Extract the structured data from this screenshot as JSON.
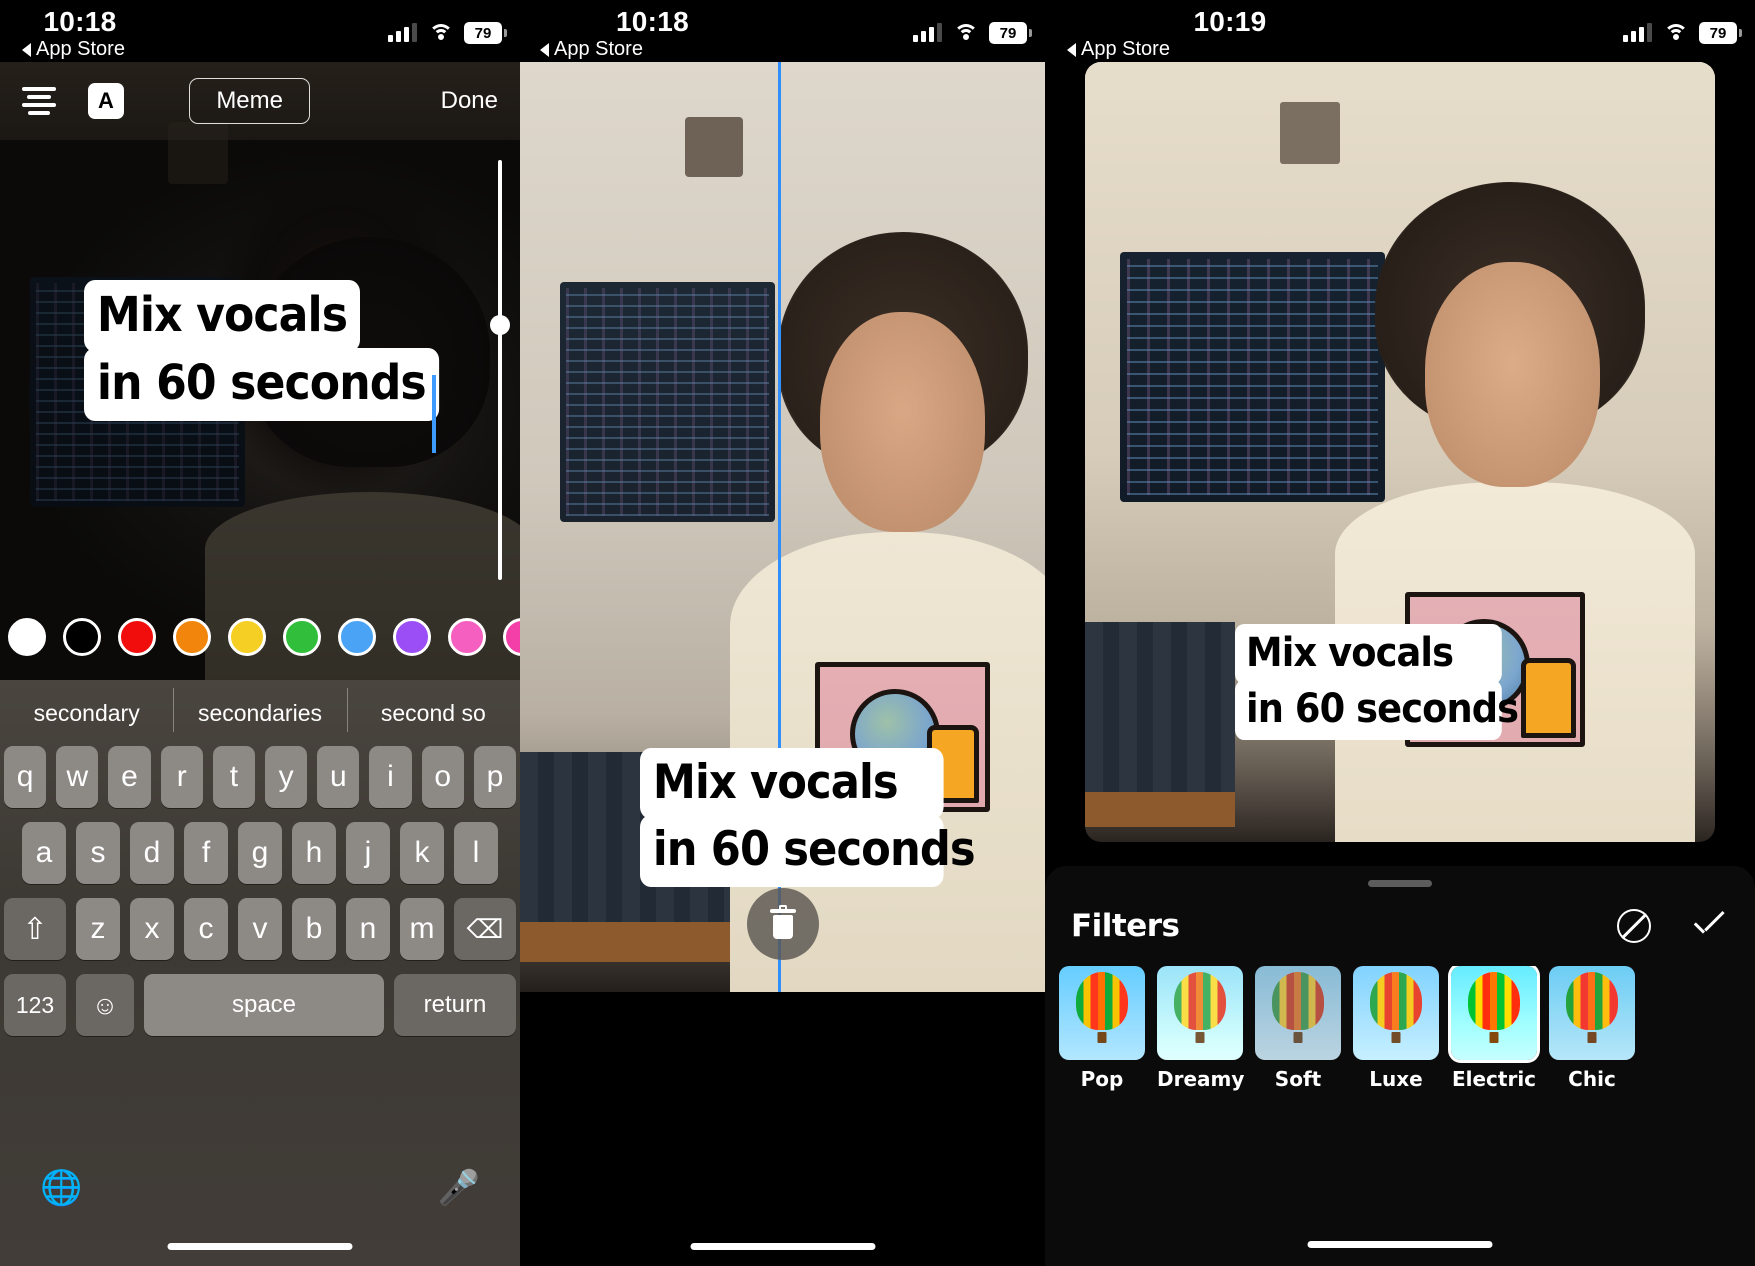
{
  "panels": [
    {
      "status": {
        "time": "10:18",
        "back_label": "App Store",
        "battery": "79",
        "signal_icon": "cellular-bars-icon",
        "wifi_icon": "wifi-icon",
        "battery_icon": "battery-icon"
      },
      "toolbar": {
        "align_icon": "text-align-icon",
        "font_label": "A",
        "style_pill": "Meme",
        "done_label": "Done"
      },
      "meme_text": {
        "line1": "Mix vocals",
        "line2": "in 60 seconds"
      },
      "colors": [
        "#ffffff",
        "#000000",
        "#f20d0d",
        "#f2860d",
        "#f5cf24",
        "#31be3b",
        "#4aa3f5",
        "#9b4ef5",
        "#f55fc0",
        "#f53fa8"
      ],
      "keyboard": {
        "suggestions": [
          "secondary",
          "secondaries",
          "second so"
        ],
        "row1": [
          "q",
          "w",
          "e",
          "r",
          "t",
          "y",
          "u",
          "i",
          "o",
          "p"
        ],
        "row2": [
          "a",
          "s",
          "d",
          "f",
          "g",
          "h",
          "j",
          "k",
          "l"
        ],
        "row3": [
          "z",
          "x",
          "c",
          "v",
          "b",
          "n",
          "m"
        ],
        "shift_icon": "shift-arrow-icon",
        "delete_icon": "backspace-icon",
        "numbers_label": "123",
        "emoji_icon": "emoji-smiley-icon",
        "space_label": "space",
        "return_label": "return",
        "globe_icon": "globe-icon",
        "mic_icon": "microphone-icon"
      }
    },
    {
      "status": {
        "time": "10:18",
        "back_label": "App Store",
        "battery": "79"
      },
      "meme_text": {
        "line1": "Mix vocals",
        "line2": "in 60 seconds"
      },
      "guide_color": "#2f8fff",
      "delete_icon": "trash-icon"
    },
    {
      "status": {
        "time": "10:19",
        "back_label": "App Store",
        "battery": "79"
      },
      "meme_text": {
        "line1": "Mix vocals",
        "line2": "in 60 seconds"
      },
      "filters": {
        "title": "Filters",
        "cancel_icon": "no-filter-icon",
        "confirm_icon": "checkmark-icon",
        "items": [
          {
            "label": "Pop",
            "selected": false
          },
          {
            "label": "Dreamy",
            "selected": false
          },
          {
            "label": "Soft",
            "selected": false
          },
          {
            "label": "Luxe",
            "selected": false
          },
          {
            "label": "Electric",
            "selected": true
          },
          {
            "label": "Chic",
            "selected": false
          }
        ]
      }
    }
  ]
}
